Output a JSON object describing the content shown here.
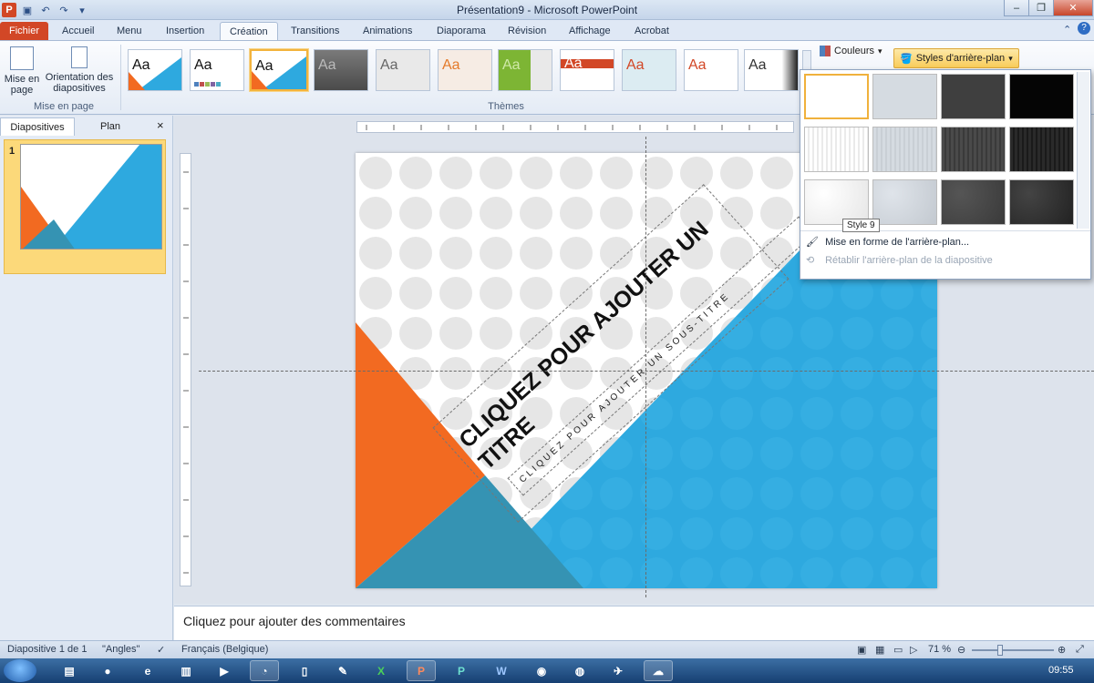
{
  "window": {
    "title": "Présentation9 - Microsoft PowerPoint"
  },
  "tabs": [
    {
      "label": "Fichier"
    },
    {
      "label": "Accueil"
    },
    {
      "label": "Menu"
    },
    {
      "label": "Insertion"
    },
    {
      "label": "Création"
    },
    {
      "label": "Transitions"
    },
    {
      "label": "Animations"
    },
    {
      "label": "Diaporama"
    },
    {
      "label": "Révision"
    },
    {
      "label": "Affichage"
    },
    {
      "label": "Acrobat"
    }
  ],
  "ribbon": {
    "page_setup": {
      "mise_en_page": "Mise en page",
      "orientation": "Orientation des diapositives",
      "group": "Mise en page"
    },
    "themes_group": "Thèmes",
    "theme_sample": "Aa",
    "couleurs": "Couleurs",
    "styles_button": "Styles d'arrière-plan"
  },
  "left_pane": {
    "tab_slides": "Diapositives",
    "tab_outline": "Plan",
    "close": "×",
    "slide_number": "1"
  },
  "slide": {
    "title": "CLIQUEZ POUR AJOUTER UN TITRE",
    "subtitle": "CLIQUEZ POUR AJOUTER UN SOUS-TITRE"
  },
  "notes": {
    "placeholder": "Cliquez pour ajouter des commentaires"
  },
  "gallery": {
    "tooltip": "Style 9",
    "format_bg": "Mise en forme de l'arrière-plan...",
    "reset_bg": "Rétablir l'arrière-plan de la diapositive"
  },
  "status": {
    "slide_info": "Diapositive 1 de 1",
    "theme": "\"Angles\"",
    "language": "Français (Belgique)",
    "zoom": "71 %"
  },
  "taskbar": {
    "clock": "09:55"
  },
  "colors": {
    "orange": "#f26a21",
    "blue": "#2ea9df",
    "teal": "#3593b3",
    "accent": "#d24726"
  }
}
